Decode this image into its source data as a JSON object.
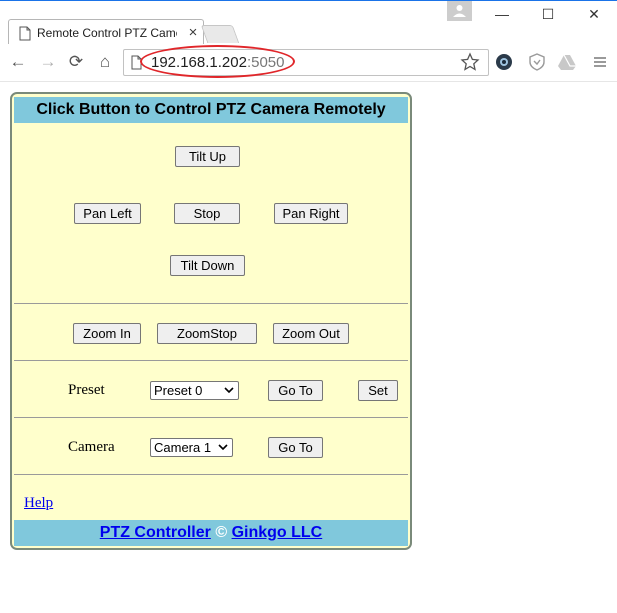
{
  "browser": {
    "tab_title": "Remote Control PTZ Camera",
    "tab_close": "×",
    "url_host": "192.168.1.202",
    "url_port": ":5050",
    "window_minimize": "—",
    "window_maximize": "☐",
    "window_close": "✕",
    "nav_back": "←",
    "nav_forward": "→",
    "nav_reload": "⟳",
    "nav_home": "⌂",
    "accent_color": "#1a73e8",
    "highlight_color": "#e0262a"
  },
  "page": {
    "title": "Click Button to Control PTZ Camera Remotely",
    "header_color": "#80c8dc",
    "panel_color": "#ffffcc",
    "pan_tilt": {
      "tilt_up": "Tilt Up",
      "pan_left": "Pan Left",
      "stop": "Stop",
      "pan_right": "Pan Right",
      "tilt_down": "Tilt Down"
    },
    "zoom": {
      "zoom_in": "Zoom In",
      "zoom_stop": "ZoomStop",
      "zoom_out": "Zoom Out"
    },
    "preset": {
      "label": "Preset",
      "selected": "Preset 0",
      "goto": "Go To",
      "set": "Set"
    },
    "camera": {
      "label": "Camera",
      "selected": "Camera 1",
      "goto": "Go To"
    },
    "help_link": "Help",
    "footer": {
      "product_link": "PTZ Controller",
      "copyright": " © ",
      "company_link": "Ginkgo LLC"
    }
  }
}
